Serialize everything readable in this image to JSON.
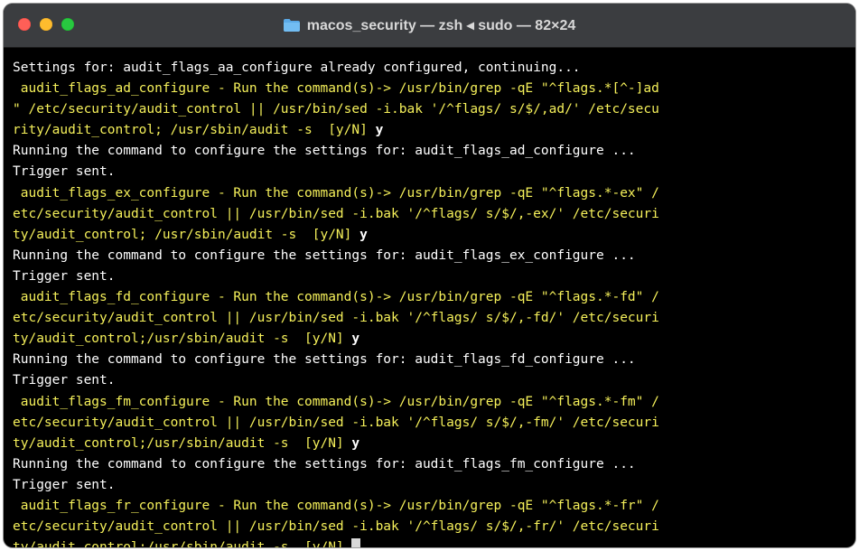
{
  "window": {
    "title": "macos_security — zsh ◂ sudo — 82×24",
    "icon": "folder-icon"
  },
  "colors": {
    "prompt": "#f5f05a",
    "output": "#ffffff",
    "background": "#000000",
    "titlebar": "#3b3d40"
  },
  "terminal": {
    "lines": [
      {
        "kind": "output",
        "text": "Settings for: audit_flags_aa_configure already configured, continuing..."
      },
      {
        "kind": "prompt",
        "text": " audit_flags_ad_configure - Run the command(s)-> /usr/bin/grep -qE \"^flags.*[^-]ad"
      },
      {
        "kind": "prompt",
        "text": "\" /etc/security/audit_control || /usr/bin/sed -i.bak '/^flags/ s/$/,ad/' /etc/secu"
      },
      {
        "kind": "prompt",
        "text": "rity/audit_control; /usr/sbin/audit -s  [y/N] ",
        "answer": "y"
      },
      {
        "kind": "output",
        "text": "Running the command to configure the settings for: audit_flags_ad_configure ..."
      },
      {
        "kind": "output",
        "text": "Trigger sent."
      },
      {
        "kind": "prompt",
        "text": " audit_flags_ex_configure - Run the command(s)-> /usr/bin/grep -qE \"^flags.*-ex\" /"
      },
      {
        "kind": "prompt",
        "text": "etc/security/audit_control || /usr/bin/sed -i.bak '/^flags/ s/$/,-ex/' /etc/securi"
      },
      {
        "kind": "prompt",
        "text": "ty/audit_control; /usr/sbin/audit -s  [y/N] ",
        "answer": "y"
      },
      {
        "kind": "output",
        "text": "Running the command to configure the settings for: audit_flags_ex_configure ..."
      },
      {
        "kind": "output",
        "text": "Trigger sent."
      },
      {
        "kind": "prompt",
        "text": " audit_flags_fd_configure - Run the command(s)-> /usr/bin/grep -qE \"^flags.*-fd\" /"
      },
      {
        "kind": "prompt",
        "text": "etc/security/audit_control || /usr/bin/sed -i.bak '/^flags/ s/$/,-fd/' /etc/securi"
      },
      {
        "kind": "prompt",
        "text": "ty/audit_control;/usr/sbin/audit -s  [y/N] ",
        "answer": "y"
      },
      {
        "kind": "output",
        "text": "Running the command to configure the settings for: audit_flags_fd_configure ..."
      },
      {
        "kind": "output",
        "text": "Trigger sent."
      },
      {
        "kind": "prompt",
        "text": " audit_flags_fm_configure - Run the command(s)-> /usr/bin/grep -qE \"^flags.*-fm\" /"
      },
      {
        "kind": "prompt",
        "text": "etc/security/audit_control || /usr/bin/sed -i.bak '/^flags/ s/$/,-fm/' /etc/securi"
      },
      {
        "kind": "prompt",
        "text": "ty/audit_control;/usr/sbin/audit -s  [y/N] ",
        "answer": "y"
      },
      {
        "kind": "output",
        "text": "Running the command to configure the settings for: audit_flags_fm_configure ..."
      },
      {
        "kind": "output",
        "text": "Trigger sent."
      },
      {
        "kind": "prompt",
        "text": " audit_flags_fr_configure - Run the command(s)-> /usr/bin/grep -qE \"^flags.*-fr\" /"
      },
      {
        "kind": "prompt",
        "text": "etc/security/audit_control || /usr/bin/sed -i.bak '/^flags/ s/$/,-fr/' /etc/securi"
      },
      {
        "kind": "prompt",
        "text": "ty/audit_control;/usr/sbin/audit -s  [y/N] ",
        "cursor": true
      }
    ]
  }
}
